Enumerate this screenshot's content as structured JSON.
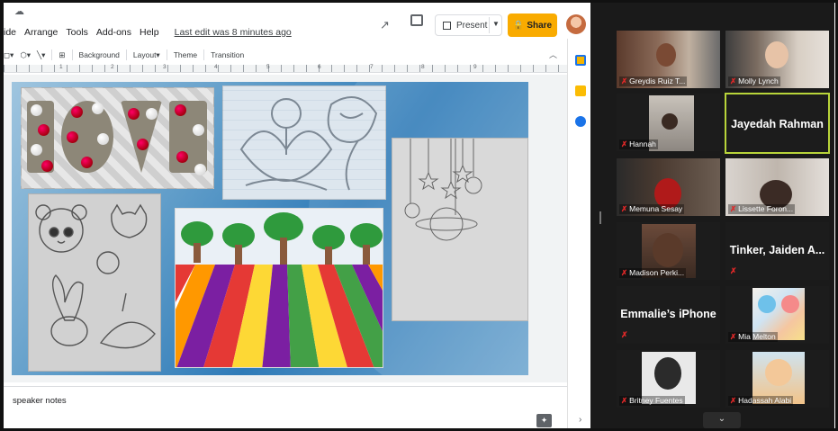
{
  "slides": {
    "menu": [
      "ide",
      "Arrange",
      "Tools",
      "Add-ons",
      "Help"
    ],
    "last_edit": "Last edit was 8 minutes ago",
    "present_label": "Present",
    "share_label": "Share",
    "toolbar": [
      "Background",
      "Layout▾",
      "Theme",
      "Transition"
    ],
    "ruler_numbers": [
      "1",
      "2",
      "3",
      "4",
      "5",
      "6",
      "7",
      "8",
      "9"
    ],
    "speaker_notes": "speaker notes",
    "accent": "#f9ab00"
  },
  "zoom": {
    "participants": [
      {
        "name": "Greydis Ruiz T..."
      },
      {
        "name": "Molly Lynch"
      },
      {
        "name": "Hannah"
      },
      {
        "name": "Jayedah Rahman"
      },
      {
        "name": "Memuna Sesay"
      },
      {
        "name": "Lissette Foron..."
      },
      {
        "name": "Madison Perki..."
      },
      {
        "name": "Tinker, Jaiden A..."
      },
      {
        "name": "Emmalie’s iPhone"
      },
      {
        "name": "Mia Melton"
      },
      {
        "name": "Britney Fuentes"
      },
      {
        "name": "Hadassah Alabi"
      }
    ],
    "active_speaker_color": "#b8d43a",
    "muted_color": "#e02828"
  }
}
